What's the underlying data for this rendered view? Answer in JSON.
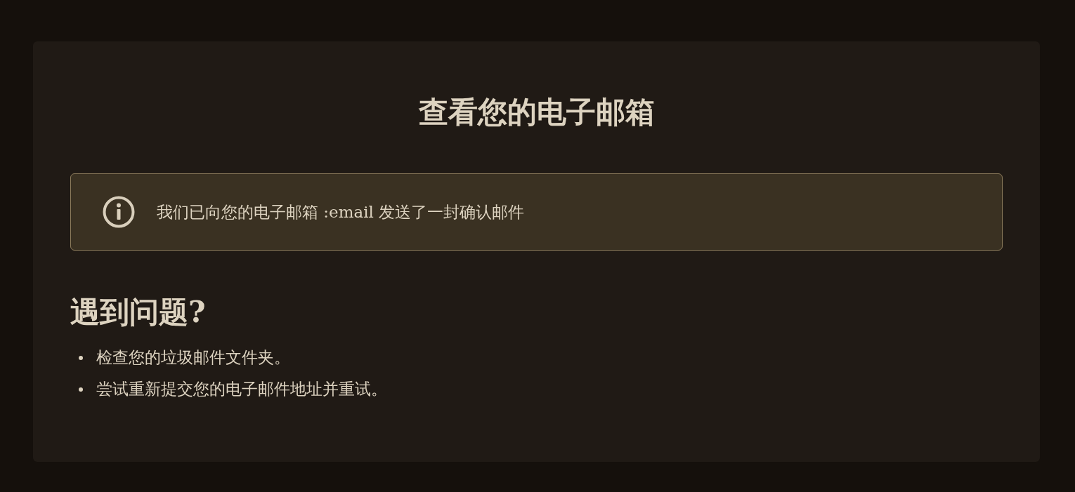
{
  "title": "查看您的电子邮箱",
  "alert": {
    "text": "我们已向您的电子邮箱 :email 发送了一封确认邮件"
  },
  "help": {
    "heading": "遇到问题?",
    "items": [
      "检查您的垃圾邮件文件夹。",
      "尝试重新提交您的电子邮件地址并重试。"
    ]
  }
}
